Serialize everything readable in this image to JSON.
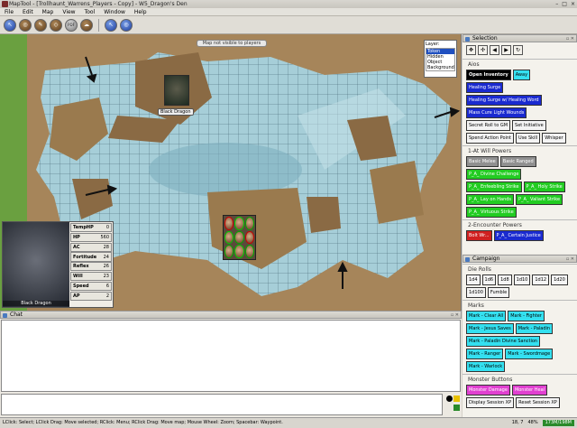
{
  "window": {
    "title": "MapTool - [Trollhaunt_Warrens_Players - Copy] - W5_Dragon's Den",
    "controls": [
      "–",
      "□",
      "×"
    ]
  },
  "menu": [
    "File",
    "Edit",
    "Map",
    "View",
    "Tool",
    "Window",
    "Help"
  ],
  "toolbar": {
    "icons": [
      "pointer-icon",
      "globe-icon",
      "draw-icon",
      "template-icon",
      "fog-icon",
      "topology-icon",
      "pointer2-icon",
      "globe2-icon"
    ],
    "pdf_label": "PDF"
  },
  "map": {
    "banner": "Map not visible to players",
    "layers": {
      "title": "Layer:",
      "items": [
        "Token",
        "Hidden",
        "Object",
        "Background"
      ],
      "selected": "Token"
    },
    "token_label": "Black Dragon",
    "colors": {
      "grass": "#5a8a3a",
      "rock": "#a6855a",
      "water": "#a6ced8",
      "grid": "#3a5a6a"
    }
  },
  "portrait": {
    "name": "Black Dragon",
    "stats": [
      {
        "label": "TempHP",
        "value": "0"
      },
      {
        "label": "HP",
        "value": "560"
      },
      {
        "label": "AC",
        "value": "28"
      },
      {
        "label": "Fortitude",
        "value": "24"
      },
      {
        "label": "Reflex",
        "value": "26"
      },
      {
        "label": "Will",
        "value": "23"
      },
      {
        "label": "Speed",
        "value": "6"
      },
      {
        "label": "AP",
        "value": "2"
      }
    ]
  },
  "chat": {
    "title": "Chat"
  },
  "selection": {
    "title": "Selection",
    "name": "Aios",
    "row1": [
      {
        "label": "Open Inventory",
        "style": "black"
      },
      {
        "label": "Away",
        "style": "cyan"
      }
    ],
    "buttons": [
      {
        "label": "Healing Surge",
        "style": "blue"
      },
      {
        "label": "Healing Surge w/ Healing Word",
        "style": "blue"
      },
      {
        "label": "Mass Cure Light Wounds",
        "style": "blue"
      },
      {
        "label": "Secret Roll to GM",
        "style": "white"
      },
      {
        "label": "Set Initiative",
        "style": "white"
      },
      {
        "label": "Spend Action Point",
        "style": "white"
      },
      {
        "label": "Use Skill",
        "style": "white"
      },
      {
        "label": "Whisper",
        "style": "white"
      }
    ],
    "atwill_title": "1-At Will Powers",
    "atwill": [
      {
        "label": "Basic Melee",
        "style": "grey"
      },
      {
        "label": "Basic Ranged",
        "style": "grey"
      },
      {
        "label": "P_A_ Divine Challenge",
        "style": "green"
      },
      {
        "label": "P_A_ Enfeebling Strike",
        "style": "green"
      },
      {
        "label": "P_A_ Holy Strike",
        "style": "green"
      },
      {
        "label": "P_A_ Lay on Hands",
        "style": "green"
      },
      {
        "label": "P_A_ Valiant Strike",
        "style": "green"
      },
      {
        "label": "P_A_ Virtuous Strike",
        "style": "green"
      }
    ],
    "encounter_title": "2-Encounter Powers",
    "encounter": [
      {
        "label": "Bolt Wr...",
        "style": "red"
      },
      {
        "label": "P_A_ Certain Justice",
        "style": "blue"
      }
    ]
  },
  "campaign": {
    "title": "Campaign",
    "dice_title": "Die Rolls",
    "dice": [
      "1d4",
      "1d6",
      "1d8",
      "1d10",
      "1d12",
      "1d20",
      "1d100",
      "Fumble"
    ],
    "marks_title": "Marks",
    "marks": [
      "Mark - Clear All",
      "Mark - Fighter",
      "Mark - Jesus Saves",
      "Mark - Paladin",
      "Mark - Paladin Divine Sanction",
      "Mark - Ranger",
      "Mark - Swordmage",
      "Mark - Warlock"
    ],
    "monster_title": "Monster Buttons",
    "monster": [
      {
        "label": "Monster Damage",
        "style": "magenta"
      },
      {
        "label": "Monster Heal",
        "style": "magenta"
      },
      {
        "label": "Display Session XP",
        "style": "white"
      },
      {
        "label": "Reset Session XP",
        "style": "white"
      }
    ]
  },
  "status": {
    "text": "LClick: Select; LClick Drag: Move selected; RClick: Menu; RClick Drag: Move map; Mouse Wheel: Zoom; Spacebar: Waypoint.",
    "coords": "18, 7",
    "zoom": "48%",
    "memory": "173M/198M"
  }
}
